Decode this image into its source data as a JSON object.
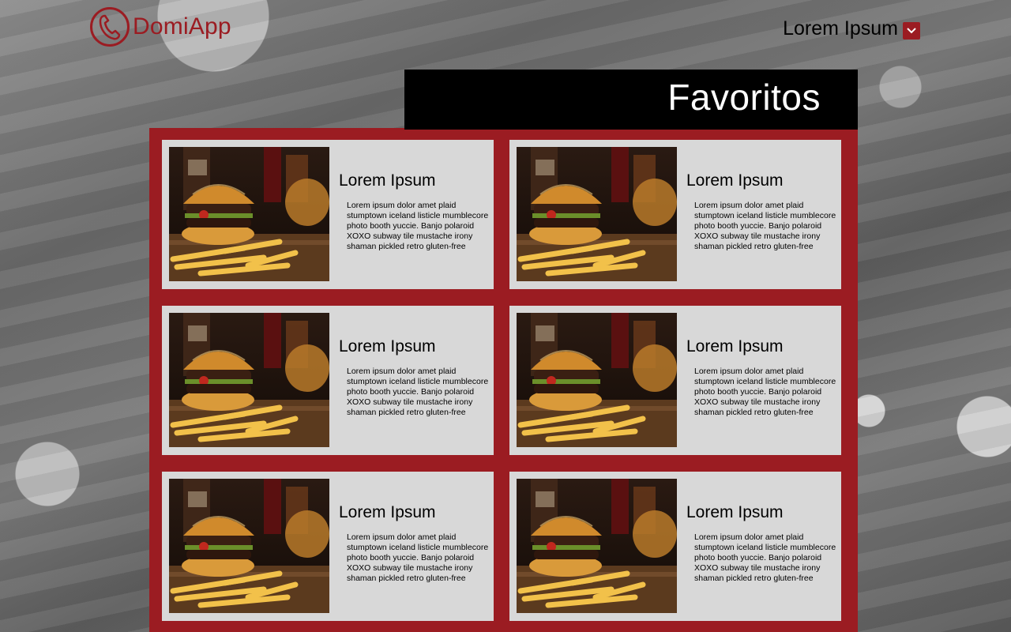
{
  "brand": {
    "name": "DomiApp",
    "icon": "phone-icon",
    "color": "#9b1c22"
  },
  "user": {
    "name": "Lorem Ipsum",
    "menu_icon": "chevron-down-icon"
  },
  "page": {
    "title": "Favoritos"
  },
  "favorites": [
    {
      "title": "Lorem Ipsum",
      "description": "Lorem ipsum dolor amet plaid stumptown iceland listicle mumblecore photo booth yuccie. Banjo polaroid XOXO subway tile mustache irony shaman pickled retro gluten-free",
      "image": "burger-fries-photo"
    },
    {
      "title": "Lorem Ipsum",
      "description": "Lorem ipsum dolor amet plaid stumptown iceland listicle mumblecore photo booth yuccie. Banjo polaroid XOXO subway tile mustache irony shaman pickled retro gluten-free",
      "image": "burger-fries-photo"
    },
    {
      "title": "Lorem Ipsum",
      "description": "Lorem ipsum dolor amet plaid stumptown iceland listicle mumblecore photo booth yuccie. Banjo polaroid XOXO subway tile mustache irony shaman pickled retro gluten-free",
      "image": "burger-fries-photo"
    },
    {
      "title": "Lorem Ipsum",
      "description": "Lorem ipsum dolor amet plaid stumptown iceland listicle mumblecore photo booth yuccie. Banjo polaroid XOXO subway tile mustache irony shaman pickled retro gluten-free",
      "image": "burger-fries-photo"
    },
    {
      "title": "Lorem Ipsum",
      "description": "Lorem ipsum dolor amet plaid stumptown iceland listicle mumblecore photo booth yuccie. Banjo polaroid XOXO subway tile mustache irony shaman pickled retro gluten-free",
      "image": "burger-fries-photo"
    },
    {
      "title": "Lorem Ipsum",
      "description": "Lorem ipsum dolor amet plaid stumptown iceland listicle mumblecore photo booth yuccie. Banjo polaroid XOXO subway tile mustache irony shaman pickled retro gluten-free",
      "image": "burger-fries-photo"
    }
  ]
}
